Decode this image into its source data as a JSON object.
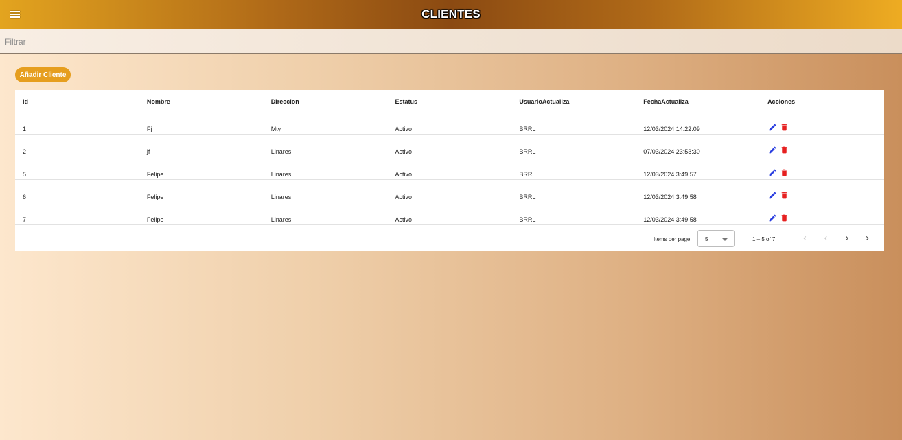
{
  "header": {
    "title": "CLIENTES",
    "menu_icon": "menu-icon"
  },
  "filter": {
    "placeholder": "Filtrar",
    "value": ""
  },
  "add_button": {
    "label": "Añadir Cliente"
  },
  "table": {
    "columns": [
      "Id",
      "Nombre",
      "Direccion",
      "Estatus",
      "UsuarioActualiza",
      "FechaActualiza",
      "Acciones"
    ],
    "rows": [
      {
        "id": "1",
        "nombre": "Fj",
        "direccion": "Mty",
        "estatus": "Activo",
        "usuario": "BRRL",
        "fecha": "12/03/2024 14:22:09"
      },
      {
        "id": "2",
        "nombre": "jf",
        "direccion": "Linares",
        "estatus": "Activo",
        "usuario": "BRRL",
        "fecha": "07/03/2024 23:53:30"
      },
      {
        "id": "5",
        "nombre": "Felipe",
        "direccion": "Linares",
        "estatus": "Activo",
        "usuario": "BRRL",
        "fecha": "12/03/2024 3:49:57"
      },
      {
        "id": "6",
        "nombre": "Felipe",
        "direccion": "Linares",
        "estatus": "Activo",
        "usuario": "BRRL",
        "fecha": "12/03/2024 3:49:58"
      },
      {
        "id": "7",
        "nombre": "Felipe",
        "direccion": "Linares",
        "estatus": "Activo",
        "usuario": "BRRL",
        "fecha": "12/03/2024 3:49:58"
      }
    ],
    "action_icons": [
      "edit-icon",
      "delete-icon"
    ]
  },
  "paginator": {
    "items_per_page_label": "Items per page:",
    "page_size": "5",
    "range_label": "1 – 5 of 7",
    "nav_icons": [
      "first-page-icon",
      "previous-page-icon",
      "next-page-icon",
      "last-page-icon"
    ]
  },
  "colors": {
    "accent": "#e69e1e",
    "edit": "#2a3ee0",
    "delete": "#e62020"
  }
}
